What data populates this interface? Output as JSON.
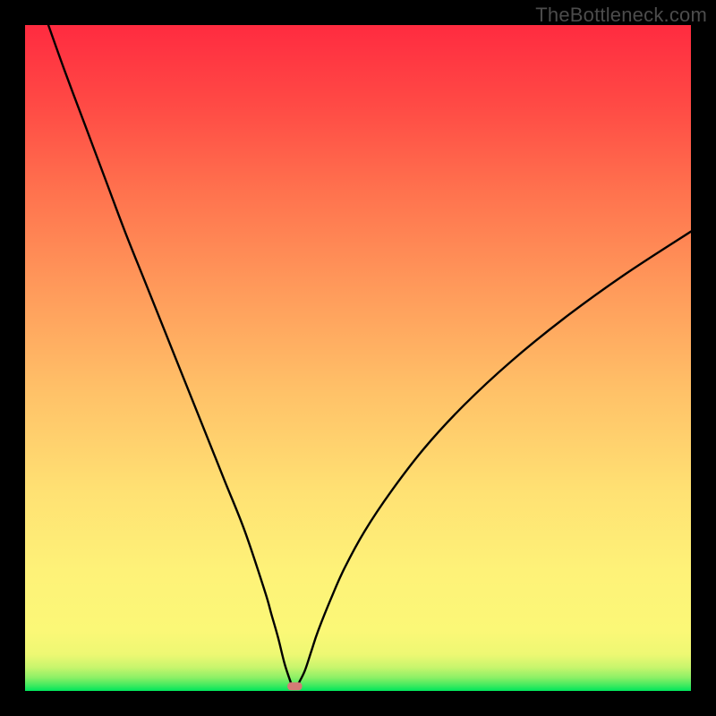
{
  "watermark": "TheBottleneck.com",
  "chart_data": {
    "type": "line",
    "title": "",
    "xlabel": "",
    "ylabel": "",
    "xlim": [
      0,
      100
    ],
    "ylim": [
      0,
      100
    ],
    "grid": false,
    "legend": false,
    "background": {
      "description": "vertical gradient, green at bottom through yellow/orange to red at top",
      "stops": [
        {
          "offset": 0.0,
          "color": "#00e65c"
        },
        {
          "offset": 0.01,
          "color": "#4beb60"
        },
        {
          "offset": 0.02,
          "color": "#8cf066"
        },
        {
          "offset": 0.035,
          "color": "#c6f56d"
        },
        {
          "offset": 0.055,
          "color": "#eef873"
        },
        {
          "offset": 0.09,
          "color": "#fbf877"
        },
        {
          "offset": 0.18,
          "color": "#fef278"
        },
        {
          "offset": 0.3,
          "color": "#ffe173"
        },
        {
          "offset": 0.45,
          "color": "#ffc168"
        },
        {
          "offset": 0.6,
          "color": "#ff9b5b"
        },
        {
          "offset": 0.75,
          "color": "#ff724e"
        },
        {
          "offset": 0.88,
          "color": "#ff4a45"
        },
        {
          "offset": 1.0,
          "color": "#ff2b40"
        }
      ]
    },
    "series": [
      {
        "name": "left-branch",
        "x": [
          3.5,
          6,
          9,
          12,
          15,
          18,
          21,
          24,
          27,
          30,
          33,
          36,
          37,
          38,
          39,
          40
        ],
        "y": [
          100,
          93,
          85,
          77,
          69,
          61.5,
          54,
          46.5,
          39,
          31.5,
          24,
          15,
          11.5,
          8,
          4,
          1
        ]
      },
      {
        "name": "right-branch",
        "x": [
          41,
          42,
          43,
          44,
          46,
          48,
          51,
          55,
          60,
          66,
          73,
          81,
          90,
          100
        ],
        "y": [
          1,
          3,
          6,
          9,
          14,
          18.5,
          24,
          30,
          36.5,
          43,
          49.5,
          56,
          62.5,
          69
        ]
      }
    ],
    "marker": {
      "name": "optimum-marker",
      "x": 40.5,
      "y": 0.7,
      "color": "#d47b76",
      "shape": "rounded-rect",
      "w": 2.2,
      "h": 1.2
    }
  }
}
